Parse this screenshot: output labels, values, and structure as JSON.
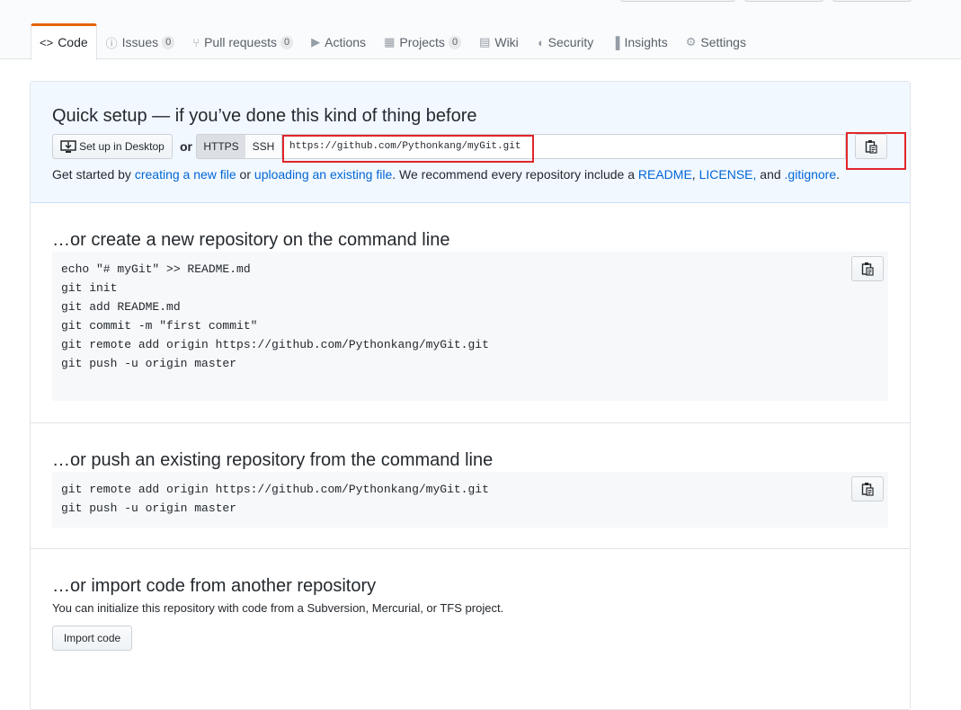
{
  "tabs": [
    {
      "icon": "code-icon",
      "glyph": "<>",
      "label": "Code",
      "counter": ""
    },
    {
      "icon": "issue-icon",
      "glyph": "ⓘ",
      "label": "Issues",
      "counter": "0"
    },
    {
      "icon": "pull-request-icon",
      "glyph": "⑂",
      "label": "Pull requests",
      "counter": "0"
    },
    {
      "icon": "play-icon",
      "glyph": "▶",
      "label": "Actions",
      "counter": ""
    },
    {
      "icon": "project-icon",
      "glyph": "▦",
      "label": "Projects",
      "counter": "0"
    },
    {
      "icon": "book-icon",
      "glyph": "▤",
      "label": "Wiki",
      "counter": ""
    },
    {
      "icon": "shield-icon",
      "glyph": "◖",
      "label": "Security",
      "counter": ""
    },
    {
      "icon": "graph-icon",
      "glyph": "▐",
      "label": "Insights",
      "counter": ""
    },
    {
      "icon": "gear-icon",
      "glyph": "⚙",
      "label": "Settings",
      "counter": ""
    }
  ],
  "quick_setup": {
    "title": "Quick setup — if you’ve done this kind of thing before",
    "desktop_label": "Set up in Desktop",
    "or_label": "or",
    "https_label": "HTTPS",
    "ssh_label": "SSH",
    "clone_url": "https://github.com/Pythonkang/myGit.git",
    "help": {
      "t1": "Get started by ",
      "link1": "creating a new file",
      "t2": " or ",
      "link2": "uploading an existing file",
      "t3": ". We recommend every repository include a ",
      "link3": "README",
      "t4": ", ",
      "link4": "LICENSE,",
      "t5": " and ",
      "link5": ".gitignore",
      "t6": "."
    }
  },
  "create_section": {
    "title": "…or create a new repository on the command line",
    "lines": [
      "echo \"# myGit\" >> README.md",
      "git init",
      "git add README.md",
      "git commit -m \"first commit\"",
      "git remote add origin https://github.com/Pythonkang/myGit.git",
      "git push -u origin master"
    ]
  },
  "push_section": {
    "title": "…or push an existing repository from the command line",
    "lines": [
      "git remote add origin https://github.com/Pythonkang/myGit.git",
      "git push -u origin master"
    ]
  },
  "import_section": {
    "title": "…or import code from another repository",
    "description": "You can initialize this repository with code from a Subversion, Mercurial, or TFS project.",
    "button_label": "Import code"
  },
  "colors": {
    "accent": "#e36209",
    "link": "#0366d6",
    "highlight": "#e0262a",
    "quick_bg": "#f1f8ff"
  }
}
